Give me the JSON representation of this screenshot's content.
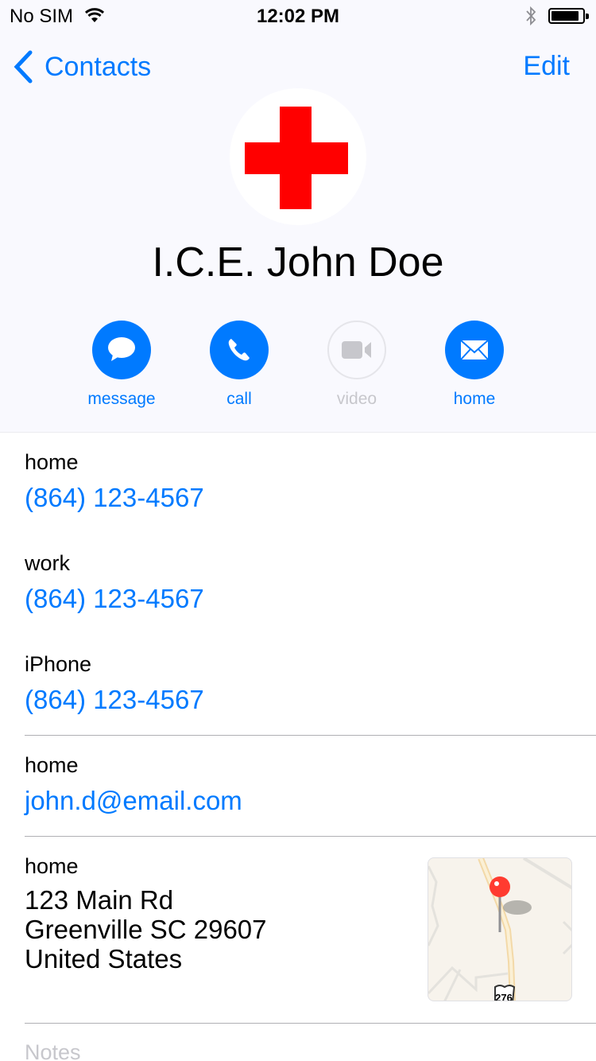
{
  "status_bar": {
    "carrier": "No SIM",
    "time": "12:02 PM",
    "icons": [
      "wifi-icon",
      "bluetooth-icon",
      "battery-icon"
    ]
  },
  "nav": {
    "back_label": "Contacts",
    "edit_label": "Edit"
  },
  "contact": {
    "name": "I.C.E. John Doe",
    "avatar": "red-cross-icon",
    "accent_color": "#007aff"
  },
  "actions": [
    {
      "label": "message",
      "icon": "message-bubble-icon",
      "enabled": true
    },
    {
      "label": "call",
      "icon": "phone-icon",
      "enabled": true
    },
    {
      "label": "video",
      "icon": "video-camera-icon",
      "enabled": false
    },
    {
      "label": "home",
      "icon": "mail-icon",
      "enabled": true
    }
  ],
  "phones": [
    {
      "label": "home",
      "value": "(864) 123-4567"
    },
    {
      "label": "work",
      "value": "(864) 123-4567"
    },
    {
      "label": "iPhone",
      "value": "(864) 123-4567"
    }
  ],
  "emails": [
    {
      "label": "home",
      "value": "john.d@email.com"
    }
  ],
  "address": {
    "label": "home",
    "lines": [
      "123 Main Rd",
      "Greenville SC 29607",
      "United States"
    ],
    "map_shield": "276"
  },
  "notes": {
    "placeholder": "Notes"
  }
}
